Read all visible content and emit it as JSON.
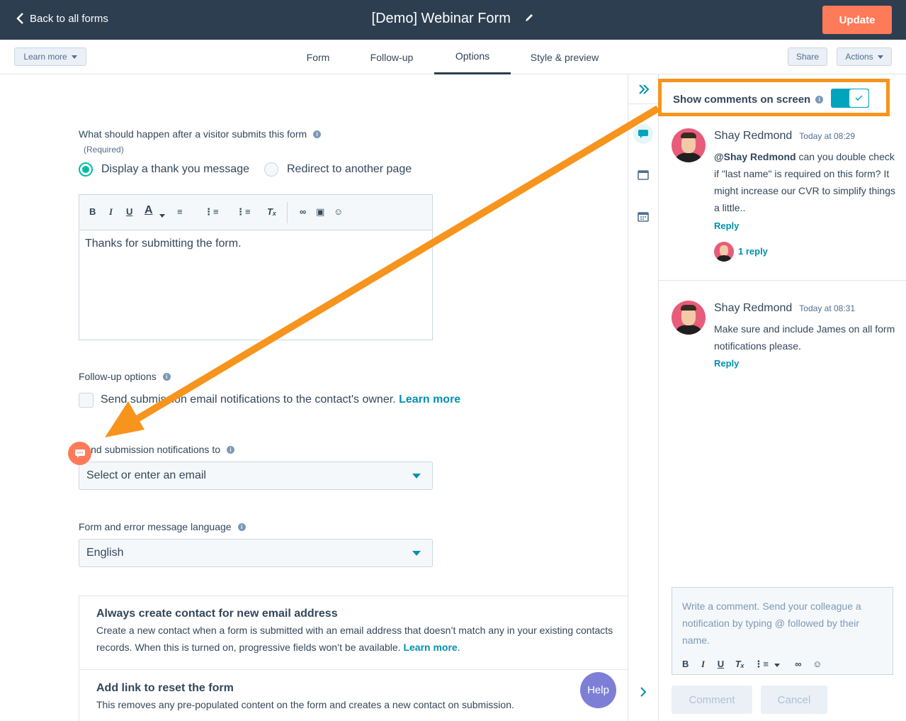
{
  "header": {
    "back_label": "Back to all forms",
    "title": "[Demo] Webinar Form",
    "update_label": "Update"
  },
  "subnav": {
    "learn_more": "Learn more",
    "tabs": [
      "Form",
      "Follow-up",
      "Options",
      "Style & preview"
    ],
    "active_tab": "Options",
    "share": "Share",
    "actions": "Actions"
  },
  "options": {
    "after_submit_label": "What should happen after a visitor submits this form",
    "required": "(Required)",
    "radio_thank_you": "Display a thank you message",
    "radio_redirect": "Redirect to another page",
    "editor_content": "Thanks for submitting the form.",
    "followup_label": "Follow-up options",
    "followup_check_text": "Send submission email notifications to the contact's owner.",
    "followup_learn_more": "Learn more",
    "notify_label": "Send submission notifications to",
    "notify_placeholder": "Select or enter an email",
    "language_label": "Form and error message language",
    "language_value": "English",
    "card1_title": "Always create contact for new email address",
    "card1_text": "Create a new contact when a form is submitted with an email address that doesn’t match any in your existing contacts records. When this is turned on, progressive fields won’t be available.",
    "card1_link": "Learn more",
    "card2_title": "Add link to reset the form",
    "card2_text": "This removes any pre-populated content on the form and creates a new contact on submission.",
    "help": "Help"
  },
  "comments": {
    "show_label": "Show comments on screen",
    "toggle_on": true,
    "items": [
      {
        "author": "Shay Redmond",
        "time": "Today at 08:29",
        "mention": "@Shay Redmond",
        "text": "can you double check if \"last name\" is required on this form? It might increase our CVR to simplify things a little..",
        "reply": "Reply",
        "replies": "1 reply"
      },
      {
        "author": "Shay Redmond",
        "time": "Today at 08:31",
        "text": "Make sure and include James on all form notifications please.",
        "reply": "Reply"
      }
    ],
    "composer_placeholder": "Write a comment. Send your colleague a notification by typing @ followed by their name.",
    "comment_btn": "Comment",
    "cancel_btn": "Cancel"
  },
  "colors": {
    "topbar": "#2d3e50",
    "accent_orange": "#ff7a59",
    "annotation_orange": "#f7941d",
    "teal": "#00a4bd",
    "link": "#0091ae"
  }
}
